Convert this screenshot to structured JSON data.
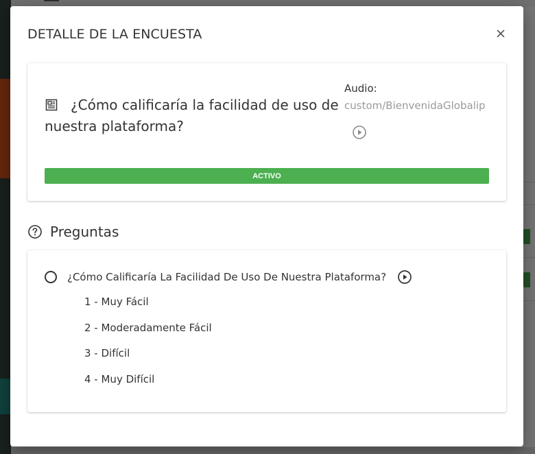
{
  "modal": {
    "title": "DETALLE DE LA ENCUESTA",
    "close_icon": "close-icon"
  },
  "survey": {
    "icon": "document-icon",
    "question": "¿Cómo calificaría la facilidad de uso de nuestra plataforma?",
    "audio_label": "Audio:",
    "audio_file": "custom/BienvenidaGlobalip",
    "audio_play_icon": "play-circle-icon",
    "status": "ACTIVO",
    "status_color": "#4caf50"
  },
  "questions": {
    "icon": "help-circle-icon",
    "title": "Preguntas",
    "items": [
      {
        "text": "¿Cómo Calificaría La Facilidad De Uso De Nuestra Plataforma?",
        "play_icon": "play-circle-icon",
        "options": [
          "1 - Muy Fácil",
          "2 - Moderadamente Fácil",
          "3 - Difícil",
          "4 - Muy Difícil"
        ]
      }
    ]
  }
}
